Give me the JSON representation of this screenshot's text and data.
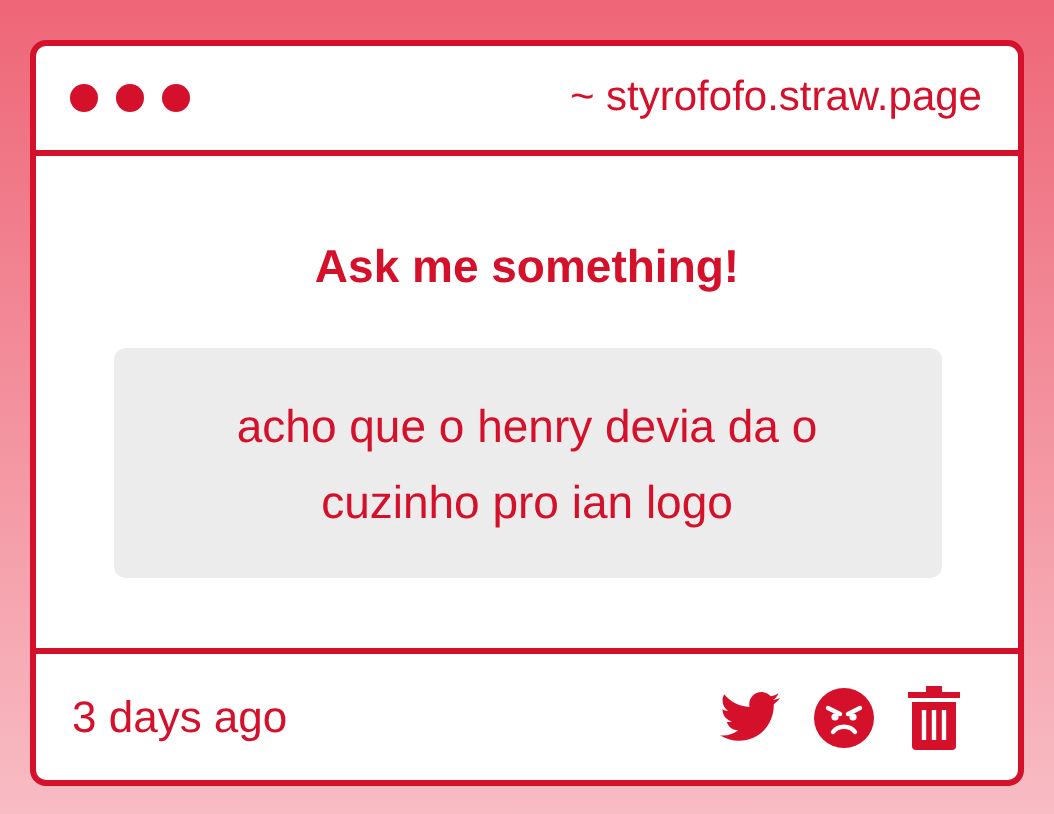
{
  "window": {
    "title": "~ styrofofo.straw.page"
  },
  "heading": "Ask me something!",
  "question": "acho que o henry devia da o cuzinho pro ian logo",
  "footer": {
    "time": "3 days ago"
  }
}
